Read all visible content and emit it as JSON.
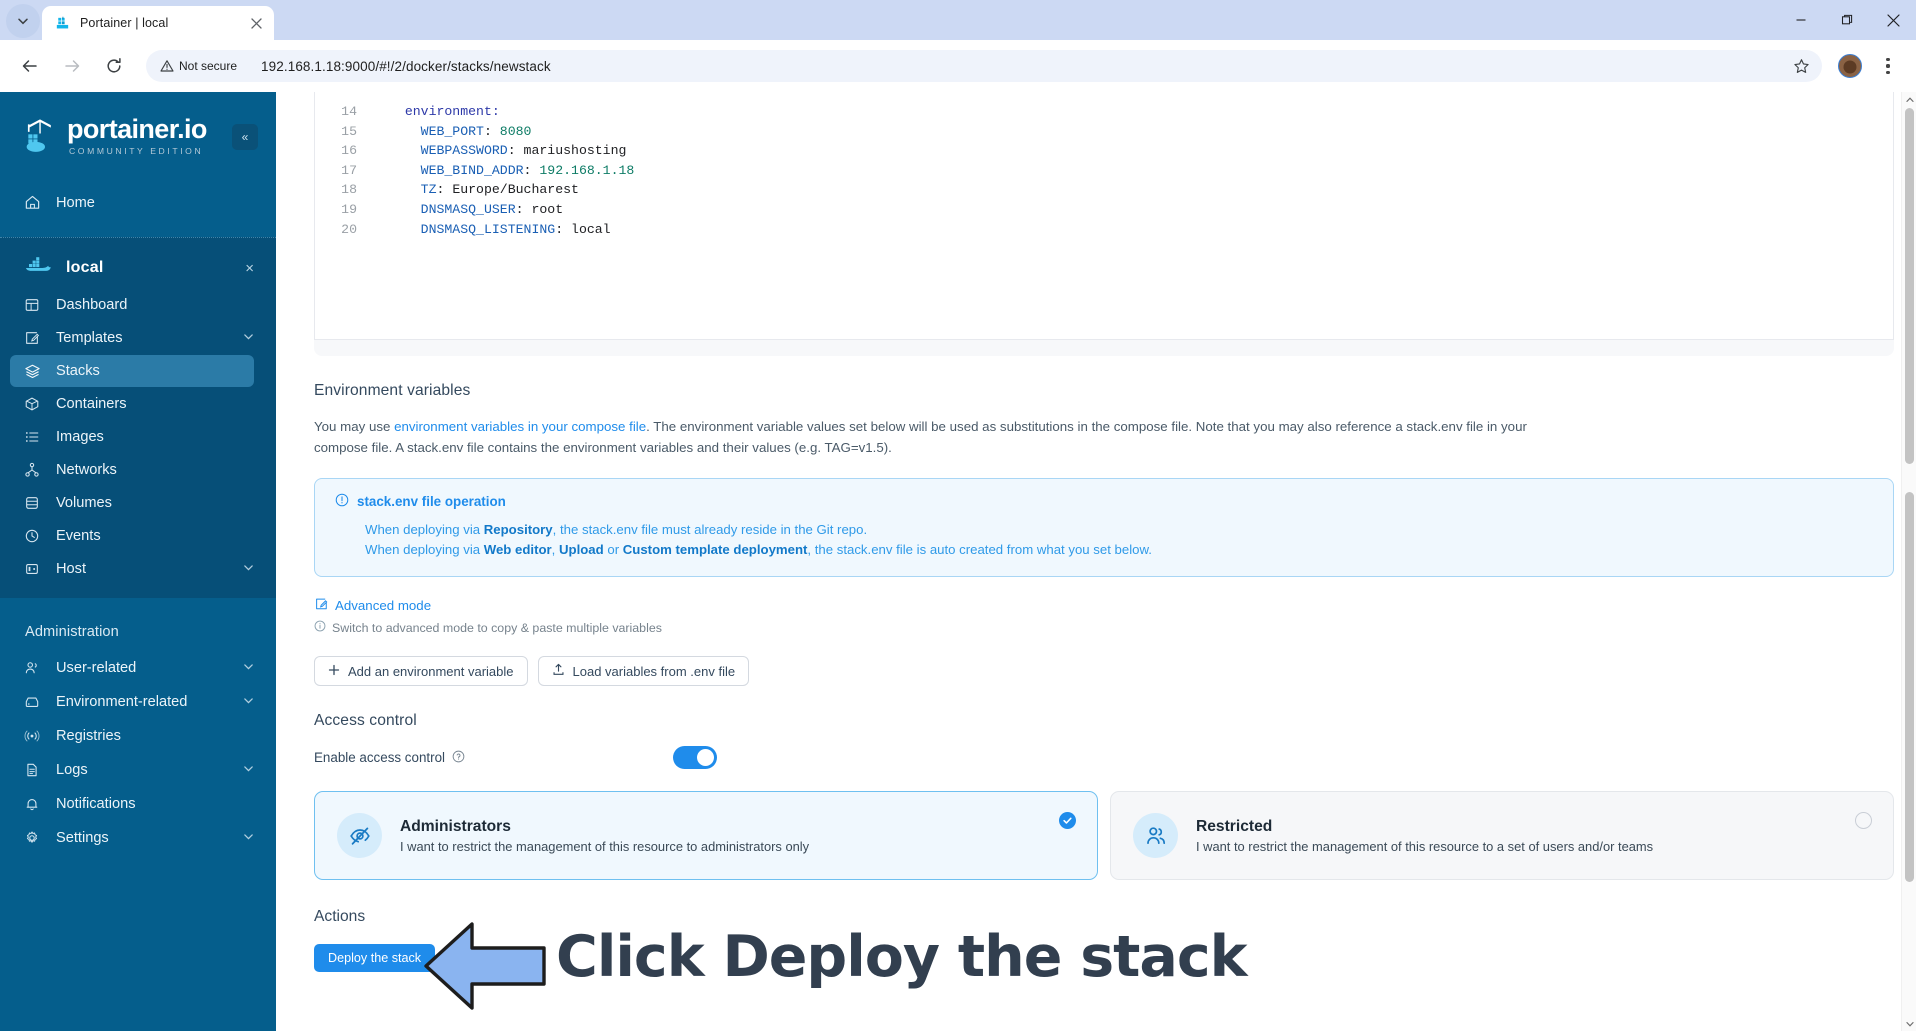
{
  "browser": {
    "tab": {
      "title": "Portainer | local",
      "favicon": "portainer-favicon"
    },
    "window_controls": {
      "minimize": "minimize-icon",
      "maximize": "maximize-icon",
      "close": "close-icon"
    },
    "toolbar": {
      "back": "back-arrow-icon",
      "forward": "forward-arrow-icon",
      "reload": "reload-icon",
      "security_label": "Not secure",
      "url": "192.168.1.18:9000/#!/2/docker/stacks/newstack",
      "bookmark": "star-icon",
      "profile": "avatar",
      "menu": "kebab-menu-icon"
    }
  },
  "sidebar": {
    "brand": {
      "name": "portainer.io",
      "edition": "COMMUNITY EDITION"
    },
    "collapse_label": "«",
    "home": {
      "label": "Home",
      "icon": "home-icon"
    },
    "environment": {
      "name": "local",
      "icon": "docker-icon",
      "close": "×",
      "items": [
        {
          "label": "Dashboard",
          "icon": "dashboard-icon",
          "chevron": false,
          "active": false
        },
        {
          "label": "Templates",
          "icon": "templates-icon",
          "chevron": true,
          "active": false
        },
        {
          "label": "Stacks",
          "icon": "stacks-icon",
          "chevron": false,
          "active": true
        },
        {
          "label": "Containers",
          "icon": "containers-icon",
          "chevron": false,
          "active": false
        },
        {
          "label": "Images",
          "icon": "images-icon",
          "chevron": false,
          "active": false
        },
        {
          "label": "Networks",
          "icon": "networks-icon",
          "chevron": false,
          "active": false
        },
        {
          "label": "Volumes",
          "icon": "volumes-icon",
          "chevron": false,
          "active": false
        },
        {
          "label": "Events",
          "icon": "events-icon",
          "chevron": false,
          "active": false
        },
        {
          "label": "Host",
          "icon": "host-icon",
          "chevron": true,
          "active": false
        }
      ]
    },
    "administration": {
      "title": "Administration",
      "items": [
        {
          "label": "User-related",
          "icon": "users-icon",
          "chevron": true
        },
        {
          "label": "Environment-related",
          "icon": "environment-icon",
          "chevron": true
        },
        {
          "label": "Registries",
          "icon": "registries-icon",
          "chevron": false
        },
        {
          "label": "Logs",
          "icon": "logs-icon",
          "chevron": true
        },
        {
          "label": "Notifications",
          "icon": "bell-icon",
          "chevron": false
        },
        {
          "label": "Settings",
          "icon": "gear-icon",
          "chevron": true
        }
      ]
    }
  },
  "editor": {
    "lines": [
      {
        "no": "14",
        "indent": 2,
        "key": "environment",
        "sep": ":",
        "value": "",
        "vtype": "none"
      },
      {
        "no": "15",
        "indent": 4,
        "key": "WEB_PORT",
        "sep": ":",
        "value": "8080",
        "vtype": "num"
      },
      {
        "no": "16",
        "indent": 4,
        "key": "WEBPASSWORD",
        "sep": ":",
        "value": "mariushosting",
        "vtype": "text"
      },
      {
        "no": "17",
        "indent": 4,
        "key": "WEB_BIND_ADDR",
        "sep": ":",
        "value": "192.168.1.18",
        "vtype": "num"
      },
      {
        "no": "18",
        "indent": 4,
        "key": "TZ",
        "sep": ":",
        "value": "Europe/Bucharest",
        "vtype": "text"
      },
      {
        "no": "19",
        "indent": 4,
        "key": "DNSMASQ_USER",
        "sep": ":",
        "value": "root",
        "vtype": "text"
      },
      {
        "no": "20",
        "indent": 4,
        "key": "DNSMASQ_LISTENING",
        "sep": ":",
        "value": "local",
        "vtype": "text"
      }
    ]
  },
  "env_vars": {
    "heading": "Environment variables",
    "desc_1": "You may use ",
    "desc_link": "environment variables in your compose file",
    "desc_2": ". The environment variable values set below will be used as substitutions in the compose file. Note that you may also reference a stack.env file in your compose file. A stack.env file contains the environment variables and their values (e.g. TAG=v1.5).",
    "infobox": {
      "icon": "info-circle-icon",
      "title": "stack.env file operation",
      "line1_a": "When deploying via ",
      "line1_b": "Repository",
      "line1_c": ", the stack.env file must already reside in the Git repo.",
      "line2_a": "When deploying via ",
      "line2_b": "Web editor",
      "line2_c": ", ",
      "line2_d": "Upload",
      "line2_e": " or ",
      "line2_f": "Custom template deployment",
      "line2_g": ", the stack.env file is auto created from what you set below."
    },
    "advanced_mode": "Advanced mode",
    "advanced_hint": "Switch to advanced mode to copy & paste multiple variables",
    "add_variable_btn": "Add an environment variable",
    "load_env_btn": "Load variables from .env file"
  },
  "access_control": {
    "heading": "Access control",
    "toggle_label": "Enable access control",
    "toggle_help": "?",
    "toggle_on": true,
    "options": [
      {
        "title": "Administrators",
        "subtitle": "I want to restrict the management of this resource to administrators only",
        "icon": "eye-off-icon",
        "selected": true
      },
      {
        "title": "Restricted",
        "subtitle": "I want to restrict the management of this resource to a set of users and/or teams",
        "icon": "users-icon",
        "selected": false
      }
    ]
  },
  "actions": {
    "heading": "Actions",
    "deploy_btn": "Deploy the stack"
  },
  "annotation": {
    "text": "Click Deploy the stack",
    "arrow": "left-arrow-annotation",
    "arrow_fill": "#8ab4f0",
    "text_color": "#323f4f"
  },
  "colors": {
    "sidebar_bg": "#055e8c",
    "sidebar_active": "#2b7ba7",
    "accent": "#1f8ceb",
    "info_bg": "#f0f8fe",
    "info_border": "#a9d6f5"
  }
}
